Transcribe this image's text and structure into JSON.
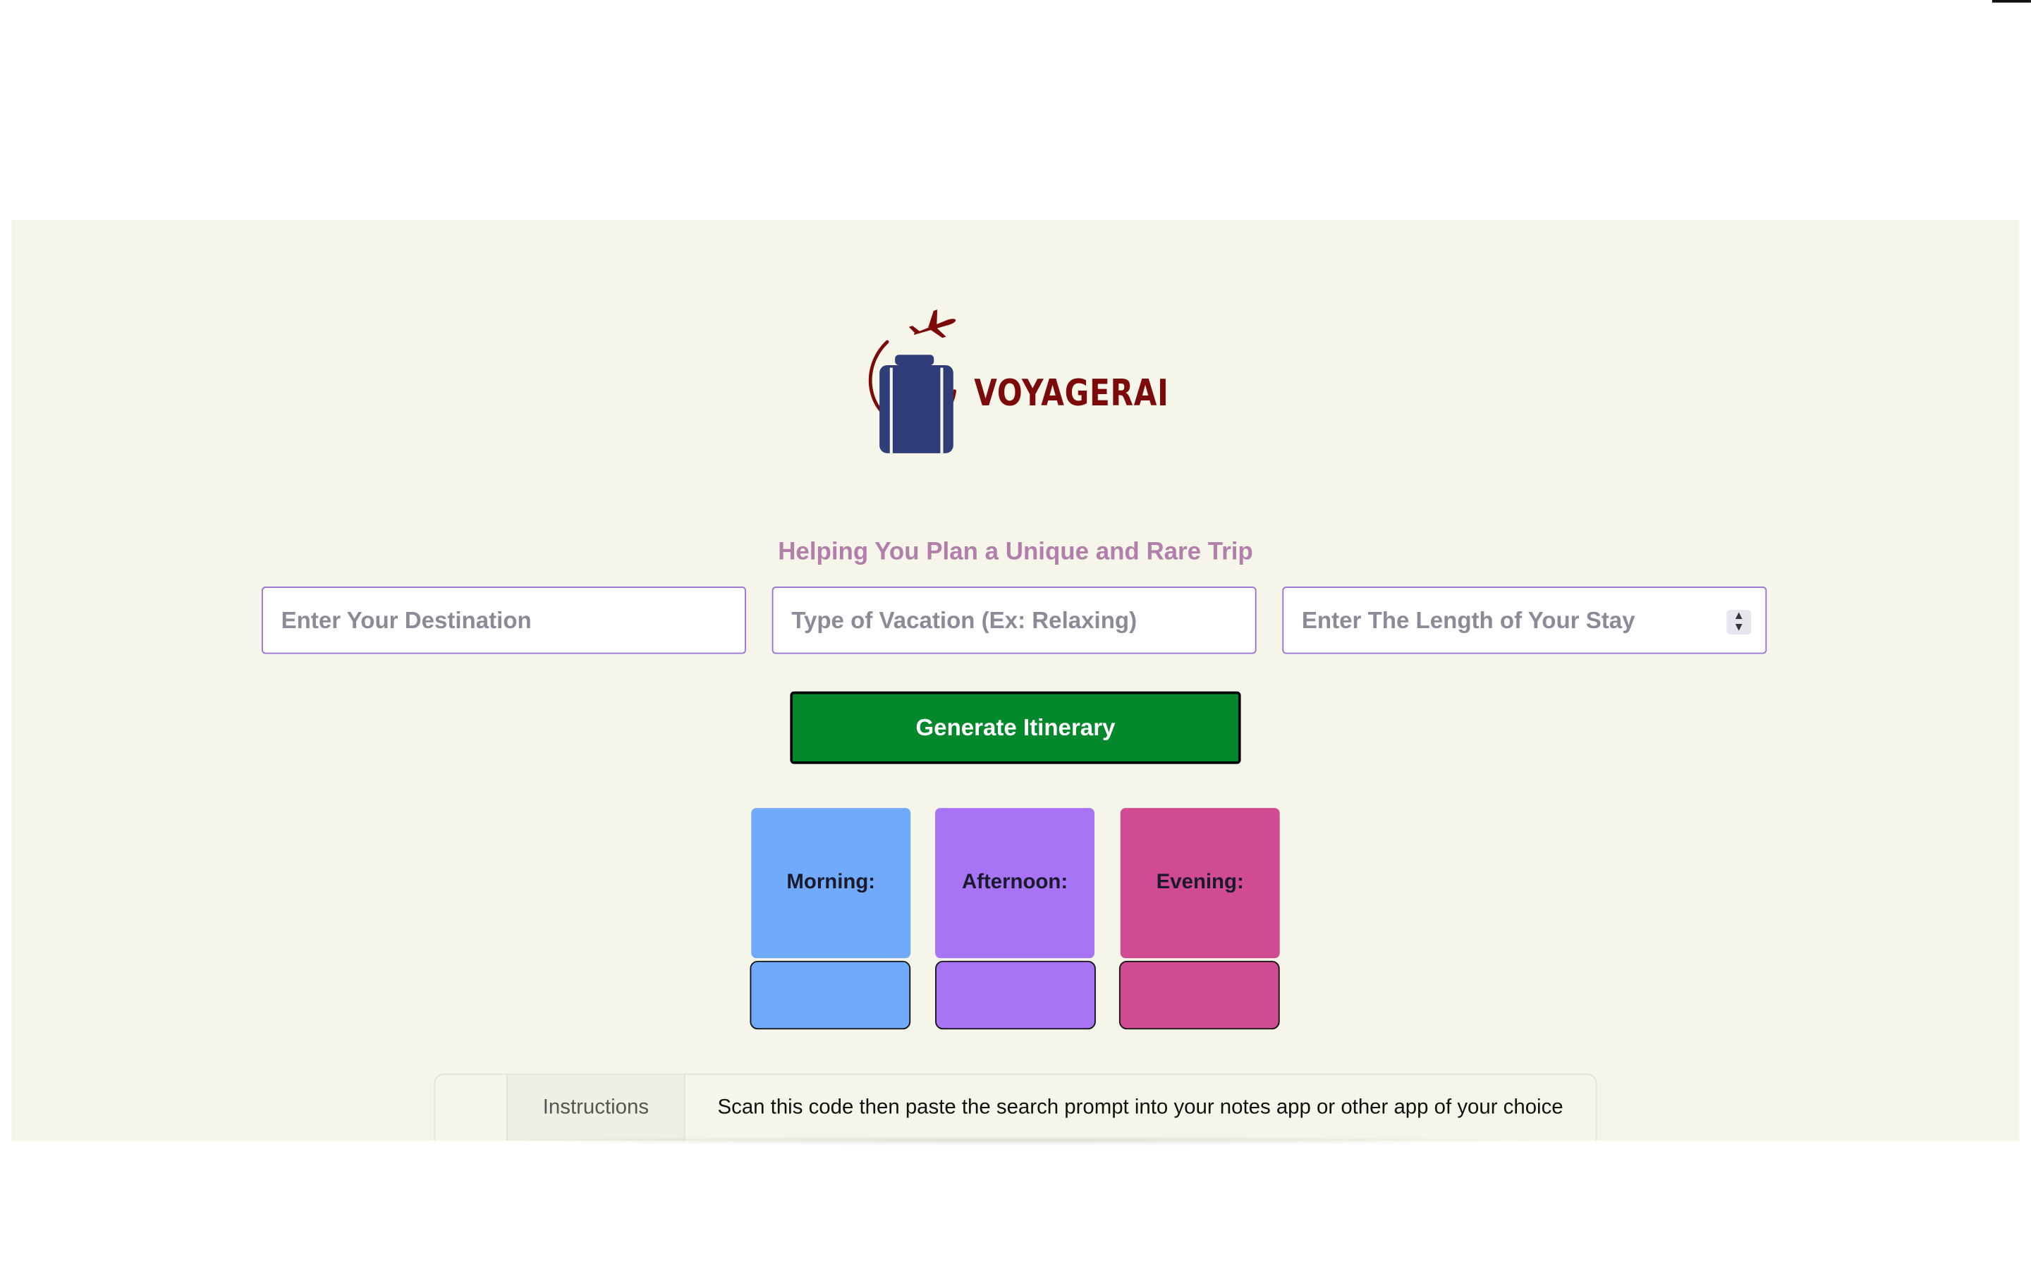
{
  "brand": {
    "name": "VOYAGERAI",
    "logo_icon": "suitcase-with-airplane-icon",
    "logo_color": "#7d0a0a",
    "suitcase_color": "#2f3e78"
  },
  "tagline": "Helping You Plan a Unique and Rare Trip",
  "form": {
    "destination": {
      "value": "",
      "placeholder": "Enter Your Destination"
    },
    "vacation_type": {
      "value": "",
      "placeholder": "Type of Vacation (Ex: Relaxing)"
    },
    "stay_length": {
      "value": "",
      "placeholder": "Enter The Length of Your Stay"
    },
    "generate_label": "Generate Itinerary"
  },
  "schedule": [
    {
      "label": "Morning:",
      "color": "#71aafa"
    },
    {
      "label": "Afternoon:",
      "color": "#a774f6"
    },
    {
      "label": "Evening:",
      "color": "#d04b91"
    }
  ],
  "instructions": {
    "tab_label": "Instructions",
    "text": "Scan this code then paste the search prompt into your notes app or other app of your choice"
  },
  "colors": {
    "panel_bg": "#f5f5ea",
    "tagline": "#b27fab",
    "input_border": "#9a6fd6",
    "button_bg": "#04882c"
  }
}
